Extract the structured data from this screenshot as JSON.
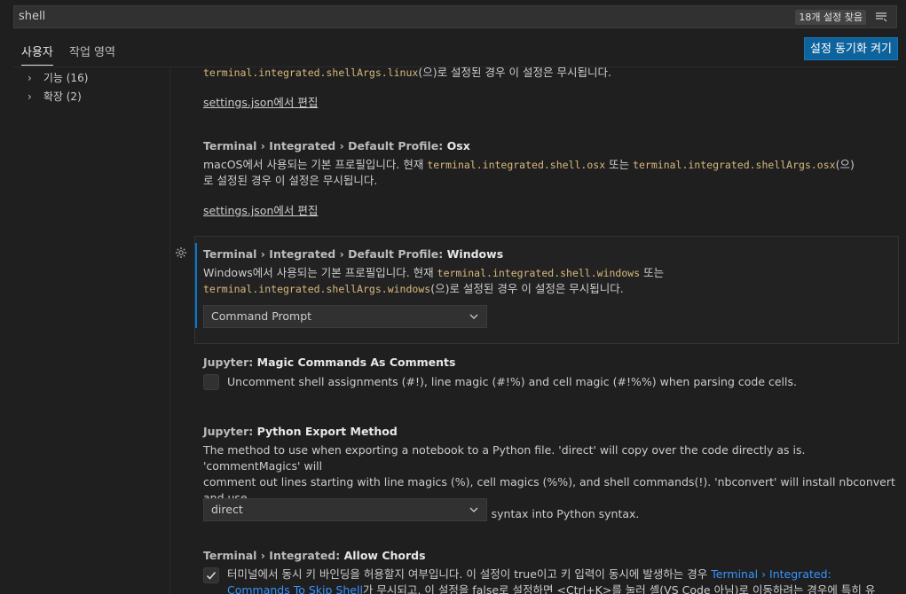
{
  "search": {
    "query": "shell",
    "result_count": "18개 설정 찾음",
    "filter_icon": "filter-icon"
  },
  "tabs": [
    {
      "label": "사용자"
    },
    {
      "label": "작업 영역"
    }
  ],
  "sync_button": "설정 동기화 켜기",
  "toc": [
    {
      "label": "기능",
      "count": "(16)"
    },
    {
      "label": "확장",
      "count": "(2)"
    }
  ],
  "settings": {
    "linux_tail": {
      "code": "terminal.integrated.shellArgs.linux",
      "text": "(으)로 설정된 경우 이 설정은 무시됩니다.",
      "edit_link": "settings.json에서 편집"
    },
    "osx": {
      "category": "Terminal › Integrated › Default Profile: ",
      "name": "Osx",
      "desc_1": "macOS에서 사용되는 기본 프로필입니다. 현재 ",
      "code_1": "terminal.integrated.shell.osx",
      "desc_2": " 또는 ",
      "code_2": "terminal.integrated.shellArgs.osx",
      "desc_3": "(으)",
      "desc_line2": "로 설정된 경우 이 설정은 무시됩니다.",
      "edit_link": "settings.json에서 편집"
    },
    "windows": {
      "category": "Terminal › Integrated › Default Profile: ",
      "name": "Windows",
      "desc_1": "Windows에서 사용되는 기본 프로필입니다. 현재 ",
      "code_1": "terminal.integrated.shell.windows",
      "desc_2": " 또는",
      "code_2": "terminal.integrated.shellArgs.windows",
      "desc_3": "(으)로 설정된 경우 이 설정은 무시됩니다.",
      "value": "Command Prompt"
    },
    "magic": {
      "category": "Jupyter: ",
      "name": "Magic Commands As Comments",
      "label": "Uncomment shell assignments (#!), line magic (#!%) and cell magic (#!%%) when parsing code cells.",
      "checked": false
    },
    "export": {
      "category": "Jupyter: ",
      "name": "Python Export Method",
      "line1": "The method to use when exporting a notebook to a Python file. 'direct' will copy over the code directly as is. 'commentMagics' will",
      "line2": "comment out lines starting with line magics (%), cell magics (%%), and shell commands(!). 'nbconvert' will install nbconvert and use",
      "line3": "that for the conversion which can translate iPython syntax into Python syntax.",
      "value": "direct"
    },
    "chords": {
      "category": "Terminal › Integrated: ",
      "name": "Allow Chords",
      "line1": "터미널에서 동시 키 바인딩을 허용할지 여부입니다. 이 설정이 true이고 키 입력이 동시에 발생하는 경우 ",
      "link1": "Terminal › Integrated:",
      "link2": "Commands To Skip Shell",
      "line2": "가 무시되고, 이 설정을 false로 설정하면 <Ctrl+K>를 눌러 셸(VS Code 아님)로 이동하려는 경우에 특히 유",
      "checked": true
    }
  }
}
